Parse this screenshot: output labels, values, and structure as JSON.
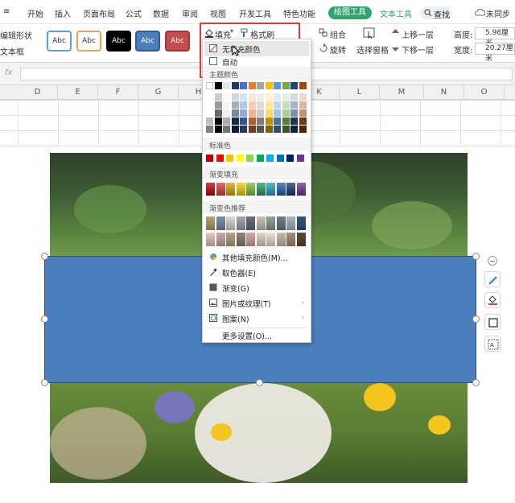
{
  "menubar": {
    "partial_left": "≡",
    "tabs": [
      "开始",
      "插入",
      "页面布局",
      "公式",
      "数据",
      "审阅",
      "视图",
      "开发工具",
      "特色功能"
    ],
    "active_tab": "绘图工具",
    "text_tool": "文本工具",
    "search": "查找",
    "sync": "未同步"
  },
  "ribbon": {
    "edit_shape": "编辑形状",
    "textbox": "文本框",
    "style_label": "Abc",
    "fill": "填充",
    "format_painter": "格式刷",
    "group": "组合",
    "rotate": "旋转",
    "selection_pane": "选择窗格",
    "bring_forward": "上移一层",
    "send_backward": "下移一层",
    "height_label": "高度:",
    "height_value": "5.98厘米",
    "width_label": "宽度:",
    "width_value": "20.27厘米"
  },
  "formula": {
    "fx": "fx"
  },
  "columns": [
    "D",
    "E",
    "F",
    "G",
    "H",
    "I",
    "J",
    "K",
    "L",
    "M",
    "N",
    "O"
  ],
  "dropdown": {
    "no_fill": "无填充颜色",
    "auto": "自动",
    "theme_colors": "主题颜色",
    "standard_colors": "标准色",
    "gradient_fill": "渐变填充",
    "gradient_recommend": "渐变色推荐",
    "more_fill_colors": "其他填充颜色(M)...",
    "eyedropper": "取色器(E)",
    "gradient": "渐变(G)",
    "picture_texture": "图片或纹理(T)",
    "pattern": "图案(N)",
    "more_settings": "更多设置(O)..."
  },
  "colors": {
    "accent": "#2ea56a",
    "shape_fill": "#4a7ebd",
    "highlight": "#e33b3b",
    "theme_top": [
      "#ffffff",
      "#000000",
      "#e7e6e6",
      "#1f3864",
      "#4472c4",
      "#ed7d31",
      "#a5a5a5",
      "#ffc000",
      "#5b9bd5",
      "#70ad47",
      "#264478",
      "#9e480e"
    ],
    "standard": [
      "#c00000",
      "#ff0000",
      "#ffc000",
      "#ffff00",
      "#92d050",
      "#00b050",
      "#00b0f0",
      "#0070c0",
      "#002060",
      "#7030a0"
    ],
    "gradients": [
      "#c00000",
      "#e03c3c",
      "#e0a000",
      "#f0d000",
      "#80c040",
      "#20a060",
      "#20a0d0",
      "#2060b0",
      "#203070",
      "#7030a0"
    ]
  }
}
